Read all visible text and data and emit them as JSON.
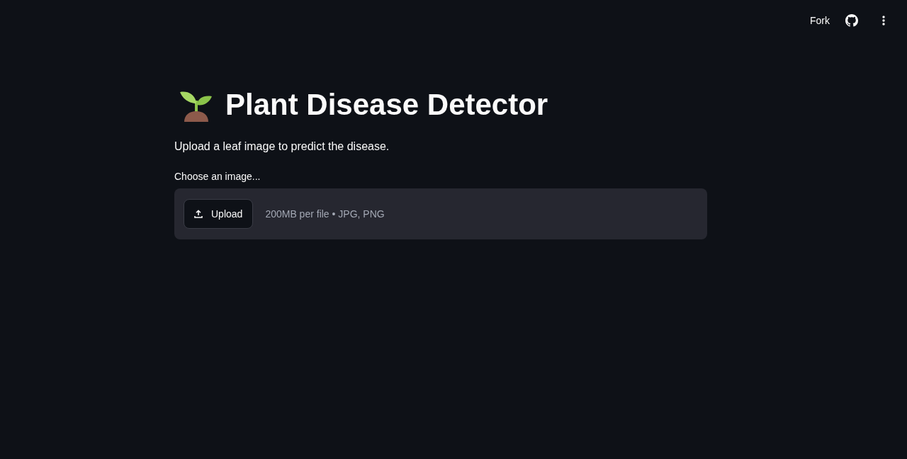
{
  "header": {
    "fork_label": "Fork"
  },
  "title": "Plant Disease Detector",
  "description": "Upload a leaf image to predict the disease.",
  "uploader": {
    "label": "Choose an image...",
    "button": "Upload",
    "hint": "200MB per file • JPG, PNG"
  }
}
